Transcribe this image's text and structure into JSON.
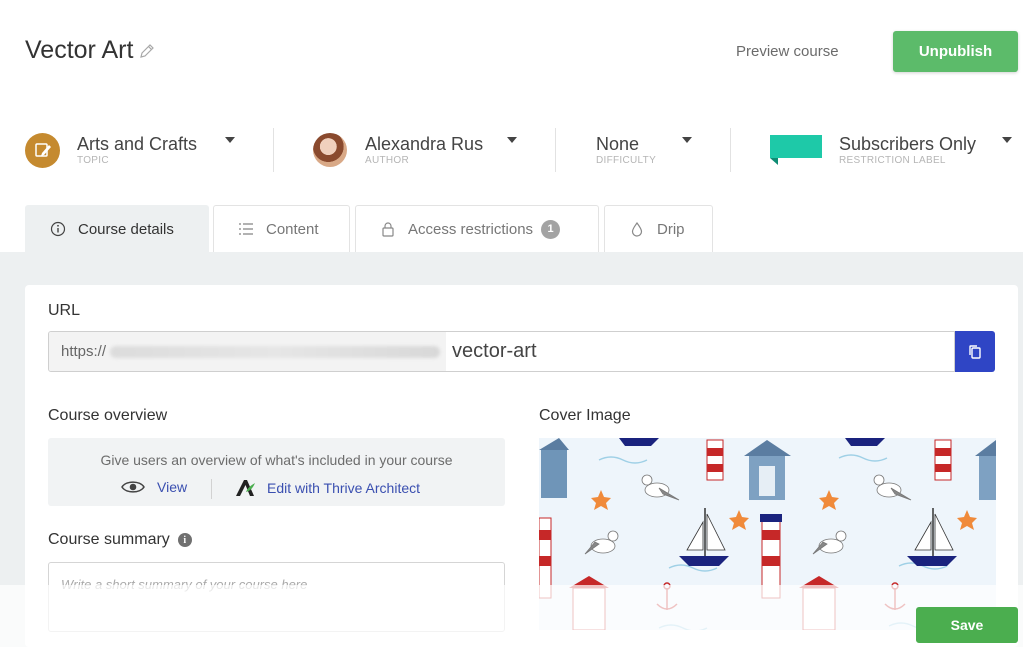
{
  "header": {
    "title": "Vector Art",
    "preview_label": "Preview course",
    "unpublish_label": "Unpublish"
  },
  "meta": {
    "topic": {
      "value": "Arts and Crafts",
      "label": "TOPIC",
      "icon": "palette-pencil-icon",
      "icon_color": "#c58a2f"
    },
    "author": {
      "value": "Alexandra Rus",
      "label": "AUTHOR"
    },
    "difficulty": {
      "value": "None",
      "label": "DIFFICULTY"
    },
    "restriction": {
      "value": "Subscribers Only",
      "label": "RESTRICTION LABEL",
      "flag_color": "#1ec9a8"
    }
  },
  "tabs": [
    {
      "label": "Course details",
      "icon": "info-icon",
      "active": true
    },
    {
      "label": "Content",
      "icon": "list-icon"
    },
    {
      "label": "Access restrictions",
      "icon": "lock-icon",
      "badge": "1"
    },
    {
      "label": "Drip",
      "icon": "drop-icon"
    }
  ],
  "url": {
    "label": "URL",
    "prefix": "https://",
    "slug": "vector-art"
  },
  "overview": {
    "label": "Course overview",
    "description": "Give users an overview of what's included in your course",
    "view_label": "View",
    "edit_label": "Edit with Thrive Architect"
  },
  "summary": {
    "label": "Course summary",
    "placeholder": "Write a short summary of your course here"
  },
  "cover": {
    "label": "Cover Image"
  },
  "footer": {
    "save_label": "Save"
  },
  "colors": {
    "accent_green": "#5cbb6a",
    "save_green": "#4bae4f",
    "copy_blue": "#2f45c5",
    "link_blue": "#3a4fb0",
    "panel_bg": "#edf0f1"
  }
}
